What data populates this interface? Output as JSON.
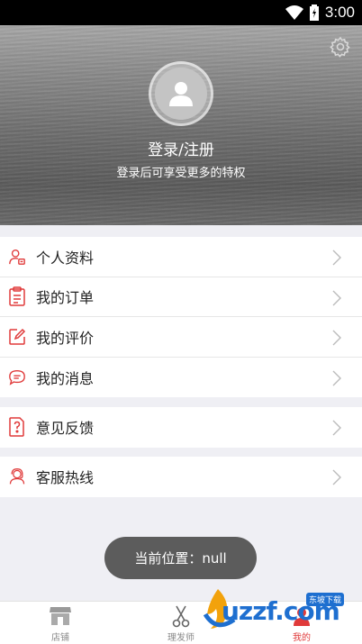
{
  "status_bar": {
    "time": "3:00"
  },
  "profile": {
    "login_title": "登录/注册",
    "login_subtitle": "登录后可享受更多的特权"
  },
  "menu": {
    "group1": [
      {
        "label": "个人资料",
        "icon": "person-card-icon"
      },
      {
        "label": "我的订单",
        "icon": "clipboard-icon"
      },
      {
        "label": "我的评价",
        "icon": "edit-icon"
      },
      {
        "label": "我的消息",
        "icon": "chat-bubble-icon"
      }
    ],
    "group2": [
      {
        "label": "意见反馈",
        "icon": "feedback-icon"
      }
    ],
    "group3": [
      {
        "label": "客服热线",
        "icon": "headset-icon"
      }
    ]
  },
  "toast": {
    "text": "当前位置：null"
  },
  "tabbar": {
    "tabs": [
      {
        "label": "店铺",
        "icon": "store-icon"
      },
      {
        "label": "理发师",
        "icon": "scissors-icon"
      },
      {
        "label": "我的",
        "icon": "profile-icon"
      }
    ],
    "active_index": 2
  },
  "watermark": {
    "text": "uzzf.com",
    "badge": "东坡下载"
  },
  "colors": {
    "accent": "#e03a3a",
    "toast_bg": "#5c5c5c",
    "page_bg": "#efeff4"
  }
}
